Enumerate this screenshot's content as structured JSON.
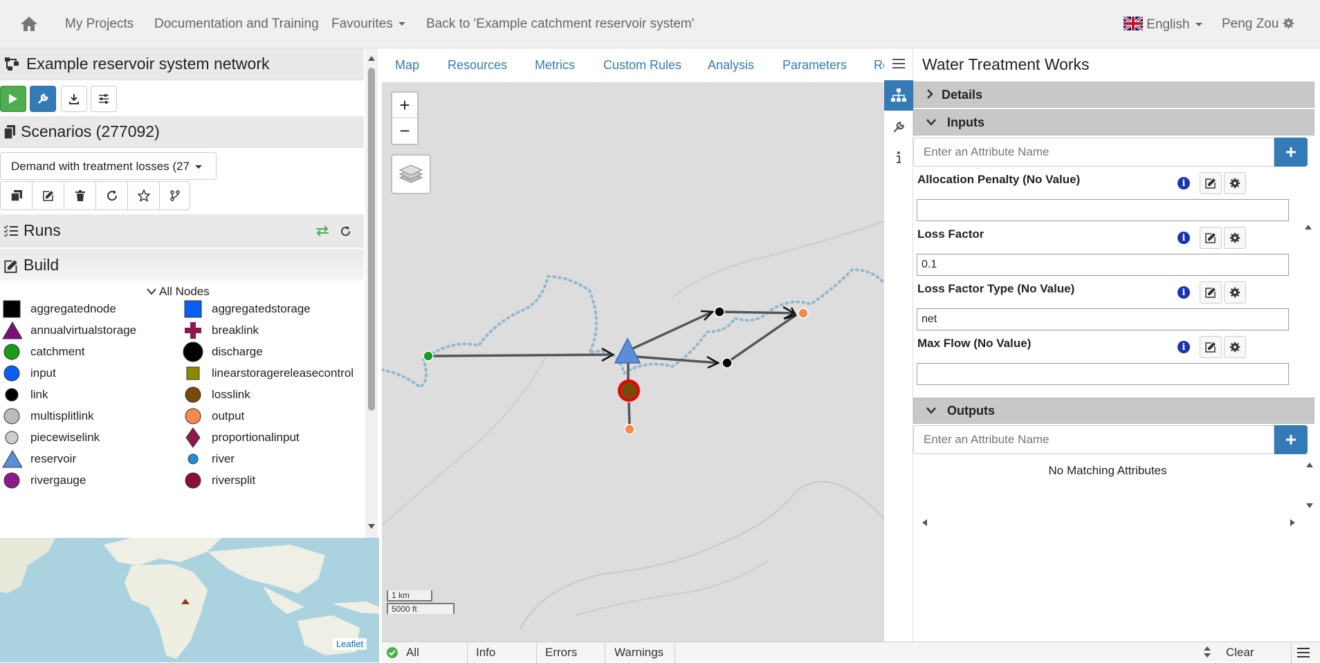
{
  "navbar": {
    "home_icon": "home-icon",
    "links": [
      "My Projects",
      "Documentation and Training",
      "Favourites",
      "Back to 'Example catchment reservoir system'"
    ],
    "language": "English",
    "user": "Peng Zou"
  },
  "network": {
    "title": "Example reservoir system network",
    "scenarios_title": "Scenarios (277092)",
    "scenario_selected": "Demand with treatment losses (27",
    "runs_title": "Runs",
    "build_title": "Build",
    "all_nodes": "All Nodes"
  },
  "legend": [
    {
      "label": "aggregatednode",
      "shape": "square",
      "color": "#000000"
    },
    {
      "label": "aggregatedstorage",
      "shape": "square",
      "color": "#0b5ef5"
    },
    {
      "label": "annualvirtualstorage",
      "shape": "triangle",
      "color": "#7a0f7a"
    },
    {
      "label": "breaklink",
      "shape": "cross",
      "color": "#8b1a4a"
    },
    {
      "label": "catchment",
      "shape": "circle",
      "color": "#1a9c1a"
    },
    {
      "label": "discharge",
      "shape": "circle-big",
      "color": "#000000"
    },
    {
      "label": "input",
      "shape": "circle",
      "color": "#0b5ef5"
    },
    {
      "label": "linearstoragereleasecontrol",
      "shape": "square-small",
      "color": "#8a8a00"
    },
    {
      "label": "link",
      "shape": "circle-small",
      "color": "#000000"
    },
    {
      "label": "losslink",
      "shape": "circle",
      "color": "#7a4a0a"
    },
    {
      "label": "multisplitlink",
      "shape": "circle",
      "color": "#bbbbbb"
    },
    {
      "label": "output",
      "shape": "circle",
      "color": "#f5894a"
    },
    {
      "label": "piecewiselink",
      "shape": "circle-small",
      "color": "#cccccc"
    },
    {
      "label": "proportionalinput",
      "shape": "diamond",
      "color": "#8b1a4a"
    },
    {
      "label": "reservoir",
      "shape": "triangle",
      "color": "#5b8ed8"
    },
    {
      "label": "river",
      "shape": "circle-tiny",
      "color": "#1e8fd5"
    },
    {
      "label": "rivergauge",
      "shape": "circle",
      "color": "#8b1a8b"
    },
    {
      "label": "riversplit",
      "shape": "circle",
      "color": "#8b0f3a"
    }
  ],
  "minimap": {
    "attribution": "Leaflet"
  },
  "map": {
    "tabs": [
      "Map",
      "Resources",
      "Metrics",
      "Custom Rules",
      "Analysis",
      "Parameters",
      "Re"
    ],
    "scale_metric": "1 km",
    "scale_imperial": "5000 ft"
  },
  "status": {
    "filters": [
      "All",
      "Info",
      "Errors",
      "Warnings"
    ],
    "clear": "Clear"
  },
  "panel": {
    "title": "Water Treatment Works",
    "details": "Details",
    "inputs": "Inputs",
    "outputs": "Outputs",
    "search_placeholder": "Enter an Attribute Name",
    "attributes": [
      {
        "label": "Allocation Penalty (No Value)",
        "value": ""
      },
      {
        "label": "Loss Factor",
        "value": "0.1"
      },
      {
        "label": "Loss Factor Type (No Value)",
        "value": "net"
      },
      {
        "label": "Max Flow (No Value)",
        "value": ""
      }
    ],
    "no_matching": "No Matching Attributes"
  }
}
